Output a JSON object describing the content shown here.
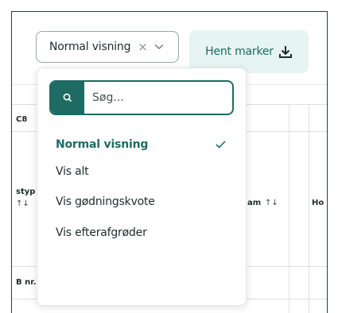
{
  "toolbar": {
    "view_select_value": "Normal visning",
    "clear_glyph": "×",
    "fetch_label": "Hent marker"
  },
  "dropdown": {
    "search_placeholder": "Søg...",
    "options": [
      {
        "label": "Normal visning",
        "selected": true
      },
      {
        "label": "Vis alt",
        "selected": false
      },
      {
        "label": "Vis gødningskvote",
        "selected": false
      },
      {
        "label": "Vis efterafgrøder",
        "selected": false
      }
    ]
  },
  "table_fragments": {
    "c8": "C8",
    "styp": "styp",
    "sort_arrows": "↑↓",
    "am_header": "am",
    "am_sort": "↑↓",
    "ho_header": "Ho",
    "b_nr": "B nr."
  },
  "colors": {
    "accent": "#1d6b62",
    "button_bg": "#e6f4f2"
  },
  "icons": [
    "clear-icon",
    "chevron-down-icon",
    "download-icon",
    "search-icon",
    "check-icon",
    "sort-icon"
  ]
}
